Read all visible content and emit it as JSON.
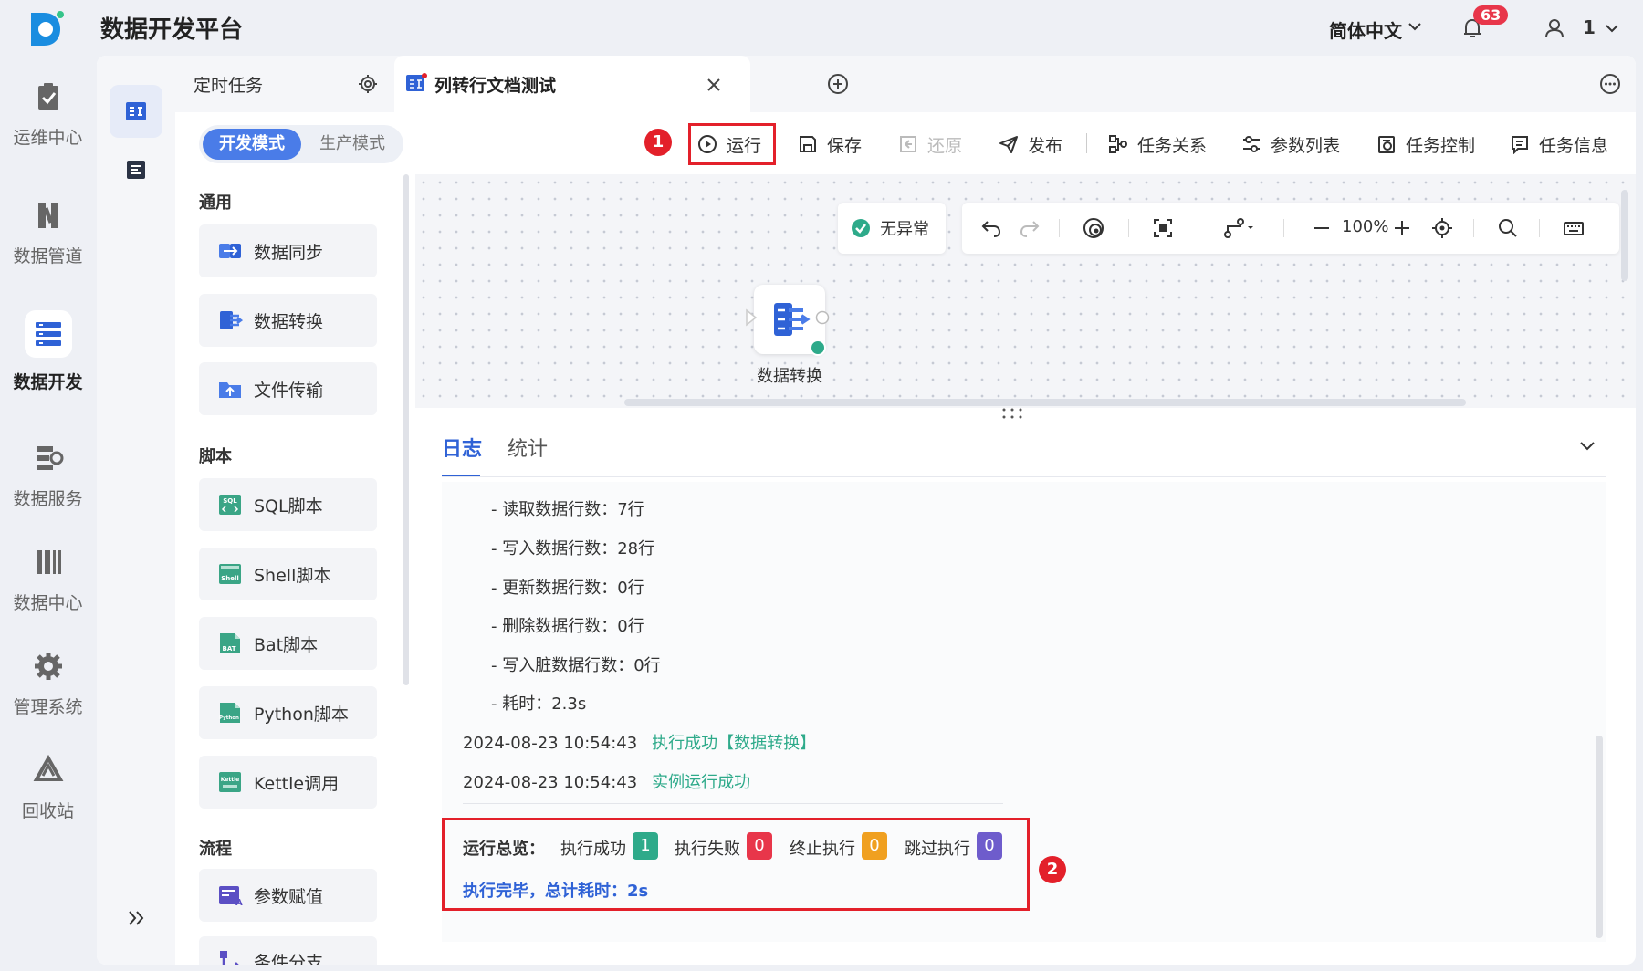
{
  "app": {
    "title": "数据开发平台",
    "language": "简体中文",
    "notification_count": "63",
    "user": "1"
  },
  "global_nav": [
    {
      "label": "运维中心",
      "icon": "clipboard-check-icon"
    },
    {
      "label": "数据管道",
      "icon": "pipeline-icon"
    },
    {
      "label": "数据开发",
      "icon": "data-dev-icon",
      "active": true
    },
    {
      "label": "数据服务",
      "icon": "data-service-icon"
    },
    {
      "label": "数据中心",
      "icon": "data-center-icon"
    },
    {
      "label": "管理系统",
      "icon": "gear-icon"
    },
    {
      "label": "回收站",
      "icon": "recycle-icon"
    }
  ],
  "tabs": [
    {
      "label": "定时任务"
    },
    {
      "label": "列转行文档测试"
    }
  ],
  "mode": {
    "dev": "开发模式",
    "prod": "生产模式"
  },
  "toolbar": {
    "run": "运行",
    "save": "保存",
    "restore": "还原",
    "publish": "发布",
    "task_relation": "任务关系",
    "param_list": "参数列表",
    "task_control": "任务控制",
    "task_info": "任务信息"
  },
  "annotations": {
    "one": "1",
    "two": "2"
  },
  "components": {
    "general_title": "通用",
    "general": [
      "数据同步",
      "数据转换",
      "文件传输"
    ],
    "script_title": "脚本",
    "scripts": [
      "SQL脚本",
      "Shell脚本",
      "Bat脚本",
      "Python脚本",
      "Kettle调用"
    ],
    "flow_title": "流程",
    "flows": [
      "参数赋值",
      "条件分支"
    ]
  },
  "canvas": {
    "status": "无异常",
    "zoom": "100%",
    "node_label": "数据转换"
  },
  "log": {
    "tabs": [
      "日志",
      "统计"
    ],
    "stats": [
      "- 读取数据行数：7行",
      "- 写入数据行数：28行",
      "- 更新数据行数：0行",
      "- 删除数据行数：0行",
      "- 写入脏数据行数：0行",
      "- 耗时：2.3s"
    ],
    "events": [
      {
        "time": "2024-08-23 10:54:43",
        "msg": "执行成功【数据转换】"
      },
      {
        "time": "2024-08-23 10:54:43",
        "msg": "实例运行成功"
      }
    ],
    "summary": {
      "title": "运行总览：",
      "success_label": "执行成功",
      "success_count": "1",
      "fail_label": "执行失败",
      "fail_count": "0",
      "stop_label": "终止执行",
      "stop_count": "0",
      "skip_label": "跳过执行",
      "skip_count": "0",
      "final": "执行完毕，总计耗时：2s"
    }
  },
  "colors": {
    "accent": "#2f62d6",
    "success": "#2eaa8a",
    "danger": "#e3202a",
    "warn": "#f0a020",
    "purple": "#6e5ccc"
  }
}
